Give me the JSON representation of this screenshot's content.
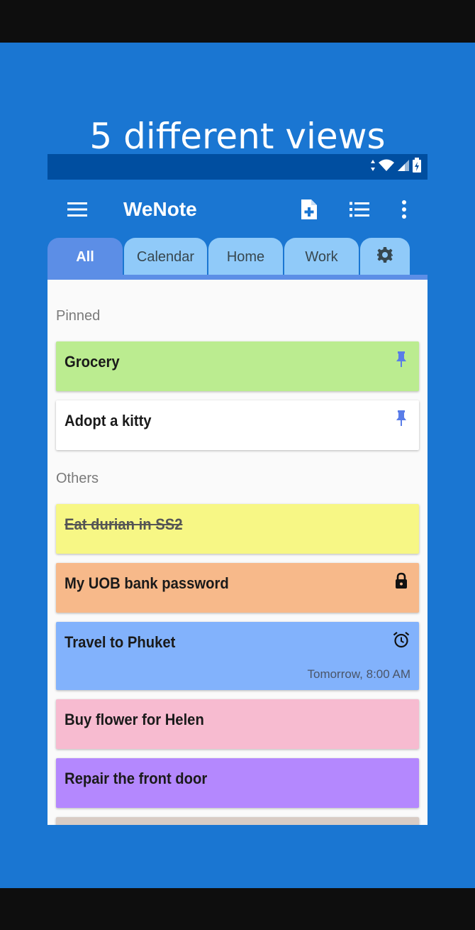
{
  "promo": {
    "title": "5 different views",
    "background": "#1a76d2"
  },
  "app": {
    "title": "WeNote",
    "icons": {
      "menu": "hamburger-menu-icon",
      "new_note": "note-add-icon",
      "view": "list-view-icon",
      "more": "more-vert-icon"
    }
  },
  "tabs": [
    {
      "label": "All",
      "active": true
    },
    {
      "label": "Calendar",
      "active": false
    },
    {
      "label": "Home",
      "active": false
    },
    {
      "label": "Work",
      "active": false
    },
    {
      "label": "",
      "icon": "settings-gear-icon",
      "active": false
    }
  ],
  "sections": {
    "pinned": "Pinned",
    "others": "Others"
  },
  "notes": {
    "pinned": [
      {
        "title": "Grocery",
        "color": "#bbec90",
        "icon": "pin-icon"
      },
      {
        "title": "Adopt a kitty",
        "color": "#ffffff",
        "icon": "pin-icon"
      }
    ],
    "others": [
      {
        "title": "Eat durian in SS2",
        "color": "#f7f785",
        "strikethrough": true
      },
      {
        "title": "My UOB bank password",
        "color": "#f7b98a",
        "icon": "lock-icon"
      },
      {
        "title": "Travel to Phuket",
        "color": "#82b2fc",
        "icon": "alarm-icon",
        "reminder": "Tomorrow, 8:00 AM"
      },
      {
        "title": "Buy flower for Helen",
        "color": "#f7bbd0"
      },
      {
        "title": "Repair the front door",
        "color": "#b488fe"
      },
      {
        "title": "",
        "color": "#d8ccc5"
      }
    ]
  }
}
